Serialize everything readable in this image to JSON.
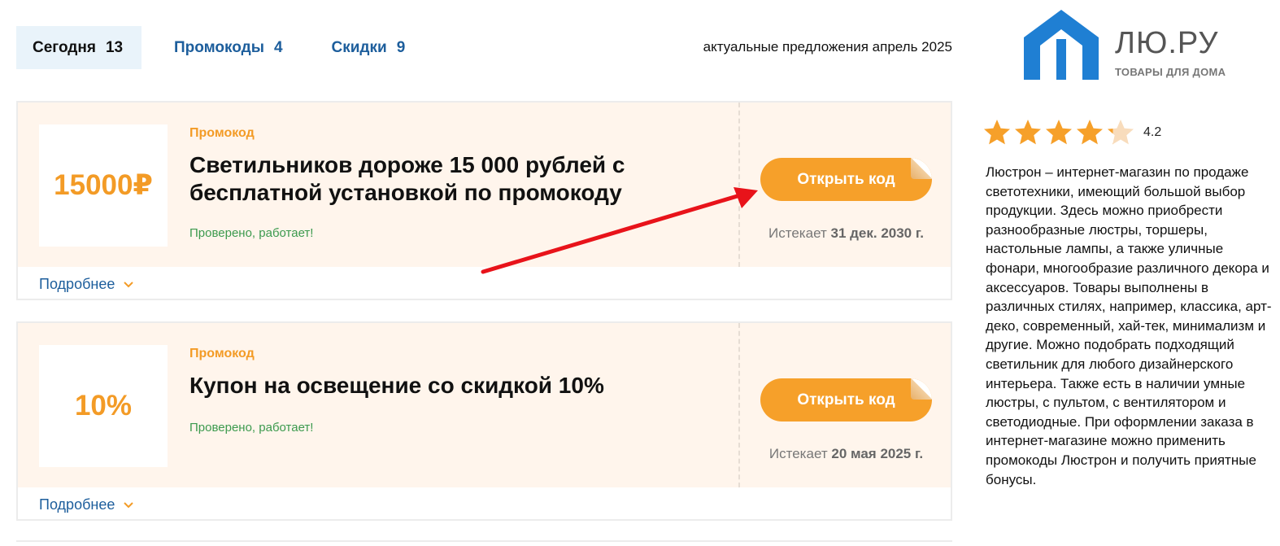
{
  "tabs": [
    {
      "label": "Сегодня",
      "count": "13"
    },
    {
      "label": "Промокоды",
      "count": "4"
    },
    {
      "label": "Скидки",
      "count": "9"
    }
  ],
  "subtitle": "актуальные предложения апрель 2025",
  "logo": {
    "name": "ЛЮ.РУ",
    "tagline": "ТОВАРЫ ДЛЯ ДОМА"
  },
  "coupons": [
    {
      "value": "15000₽",
      "type": "Промокод",
      "title": "Светильников дороже 15 000 рублей с бесплатной установкой по промокоду",
      "verified": "Проверено, работает!",
      "button": "Открыть код",
      "expires_prefix": "Истекает",
      "expires_date": "31 дек. 2030 г.",
      "more": "Подробнее"
    },
    {
      "value": "10%",
      "type": "Промокод",
      "title": "Купон на освещение со скидкой 10%",
      "verified": "Проверено, работает!",
      "button": "Открыть код",
      "expires_prefix": "Истекает",
      "expires_date": "20 мая 2025 г.",
      "more": "Подробнее"
    }
  ],
  "rating": {
    "value": "4.2",
    "score": 4.2,
    "max": 5
  },
  "description": "Люстрон – интернет-магазин по продаже светотехники, имеющий большой выбор продукции. Здесь можно приобрести разнообразные люстры, торшеры, настольные лампы, а также уличные фонари, многообразие различного декора и аксессуаров. Товары выполнены в различных стилях, например, классика, арт-деко, современный, хай-тек, минимализм и другие. Можно подобрать подходящий светильник для любого дизайнерского интерьера. Также есть в наличии умные люстры, с пультом, с вентилятором и светодиодные. При оформлении заказа в интернет-магазине можно применить промокоды Люстрон и получить приятные бонусы.",
  "colors": {
    "accent": "#f39b26",
    "button": "#f6a02a",
    "link": "#1d5e9c",
    "verified": "#3c9a4e",
    "card_bg": "#fff5ec",
    "logo_blue": "#1f7fd3",
    "arrow": "#e8131a"
  },
  "icons": [
    "house-logo-icon",
    "star-icon",
    "chevron-down-icon",
    "arrow-annotation"
  ]
}
